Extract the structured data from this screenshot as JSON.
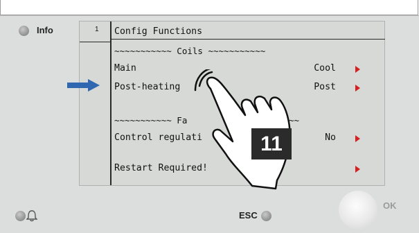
{
  "panel": {
    "info_label": "Info",
    "esc_label": "ESC",
    "ok_label": "OK"
  },
  "screen": {
    "line_number": "1",
    "title": "Config Functions",
    "section_coils": "~~~~~~~~~~~ Coils ~~~~~~~~~~~",
    "rows": [
      {
        "label": "Main",
        "value": "Cool"
      },
      {
        "label": "Post-heating",
        "value": "Post"
      }
    ],
    "section_fans": "~~~~~~~~~~~ Fa",
    "section_fans_tail": "~~",
    "control_label": "Control regulati",
    "control_value": "No",
    "restart_label": "Restart Required!"
  },
  "badge": {
    "text": "11"
  },
  "colors": {
    "arrow_red": "#d62020",
    "pointer_blue": "#2f68b0"
  }
}
